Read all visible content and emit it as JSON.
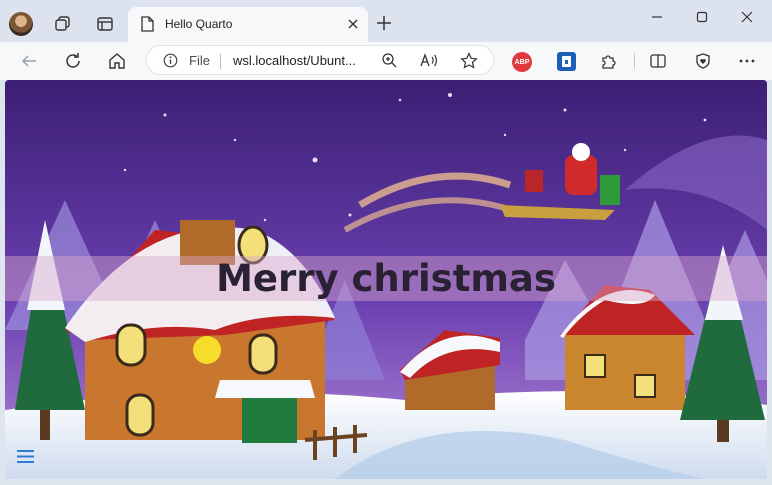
{
  "browser": {
    "tab_title": "Hello Quarto",
    "address_scheme": "File",
    "address_url": "wsl.localhost/Ubunt...",
    "extension_abp_label": "ABP"
  },
  "page": {
    "banner_text": "Merry christmas"
  },
  "icons": {
    "avatar": "profile-avatar",
    "workspaces": "workspaces-icon",
    "tab_actions": "tab-actions-icon",
    "tab_page": "page-icon",
    "close": "close-icon",
    "new_tab": "plus-icon",
    "minimize": "minimize-icon",
    "maximize": "maximize-icon",
    "back": "back-arrow-icon",
    "refresh": "refresh-icon",
    "home": "home-icon",
    "info": "info-icon",
    "zoom": "zoom-icon",
    "read_aloud": "read-aloud-icon",
    "favorite": "star-icon",
    "extensions": "puzzle-icon",
    "split_screen": "split-screen-icon",
    "browser_essentials": "heart-shield-icon",
    "more": "more-icon",
    "menu": "hamburger-icon"
  },
  "colors": {
    "sky_top": "#3b1f74",
    "sky_bottom": "#9a6bd0",
    "snow": "#f3f6fb",
    "accent_link": "#2e7bd6"
  }
}
